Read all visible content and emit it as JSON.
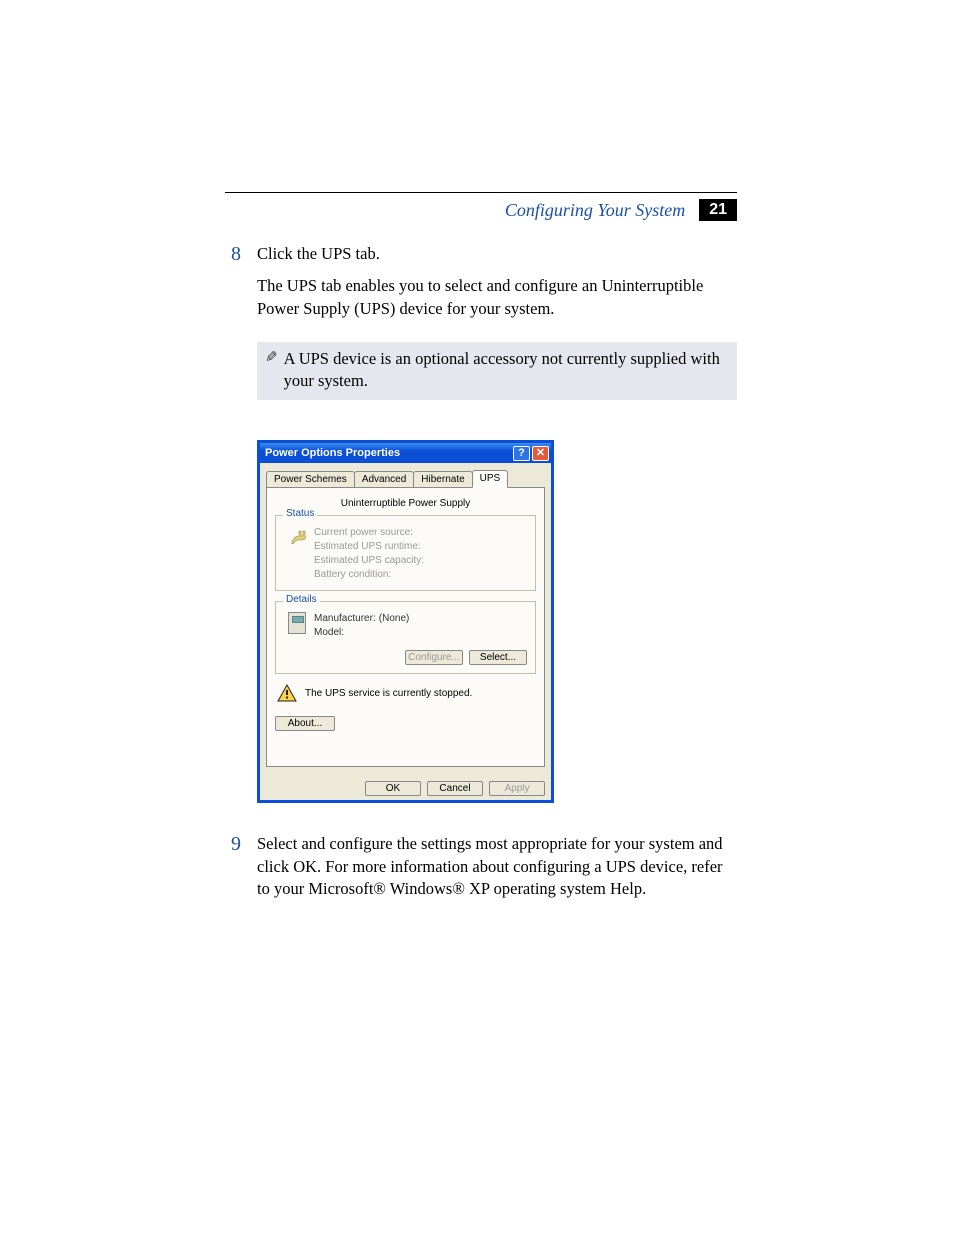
{
  "header": {
    "title": "Configuring Your System",
    "page_number": "21"
  },
  "steps": {
    "s8": {
      "num": "8",
      "line1": "Click the UPS tab.",
      "line2": "The UPS tab enables you to select and configure an Uninterruptible Power Supply (UPS) device for your system."
    },
    "s9": {
      "num": "9",
      "text": "Select and configure the settings most appropriate for your system and click OK. For more information about configuring a UPS device, refer to your Microsoft® Windows® XP operating system Help."
    }
  },
  "note": {
    "text": "A UPS device is an optional accessory not currently supplied with your system."
  },
  "dialog": {
    "title": "Power Options Properties",
    "tabs": {
      "t1": "Power Schemes",
      "t2": "Advanced",
      "t3": "Hibernate",
      "t4": "UPS"
    },
    "panel_title": "Uninterruptible Power Supply",
    "status": {
      "legend": "Status",
      "r1": "Current power source:",
      "r2": "Estimated UPS runtime:",
      "r3": "Estimated UPS capacity:",
      "r4": "Battery condition:"
    },
    "details": {
      "legend": "Details",
      "manufacturer_label": "Manufacturer:",
      "manufacturer_value": "(None)",
      "model_label": "Model:",
      "configure": "Configure...",
      "select": "Select..."
    },
    "warning": "The UPS service is currently stopped.",
    "about": "About...",
    "buttons": {
      "ok": "OK",
      "cancel": "Cancel",
      "apply": "Apply"
    }
  }
}
